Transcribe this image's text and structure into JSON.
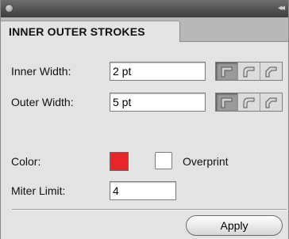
{
  "window": {
    "collapse_glyph": "◂◂"
  },
  "tab": {
    "label": "INNER OUTER STROKES"
  },
  "inner_width": {
    "label": "Inner Width:",
    "value": "2 pt",
    "selected_join": "miter"
  },
  "outer_width": {
    "label": "Outer Width:",
    "value": "5 pt",
    "selected_join": "miter"
  },
  "joins": {
    "options": [
      "miter",
      "round",
      "bevel"
    ],
    "icons": [
      "miter-join-icon",
      "round-join-icon",
      "bevel-join-icon"
    ]
  },
  "color": {
    "label": "Color:",
    "swatch_color": "#e8262a"
  },
  "overprint": {
    "label": "Overprint",
    "checked": false
  },
  "miter_limit": {
    "label": "Miter Limit:",
    "value": "4"
  },
  "actions": {
    "apply_label": "Apply"
  }
}
